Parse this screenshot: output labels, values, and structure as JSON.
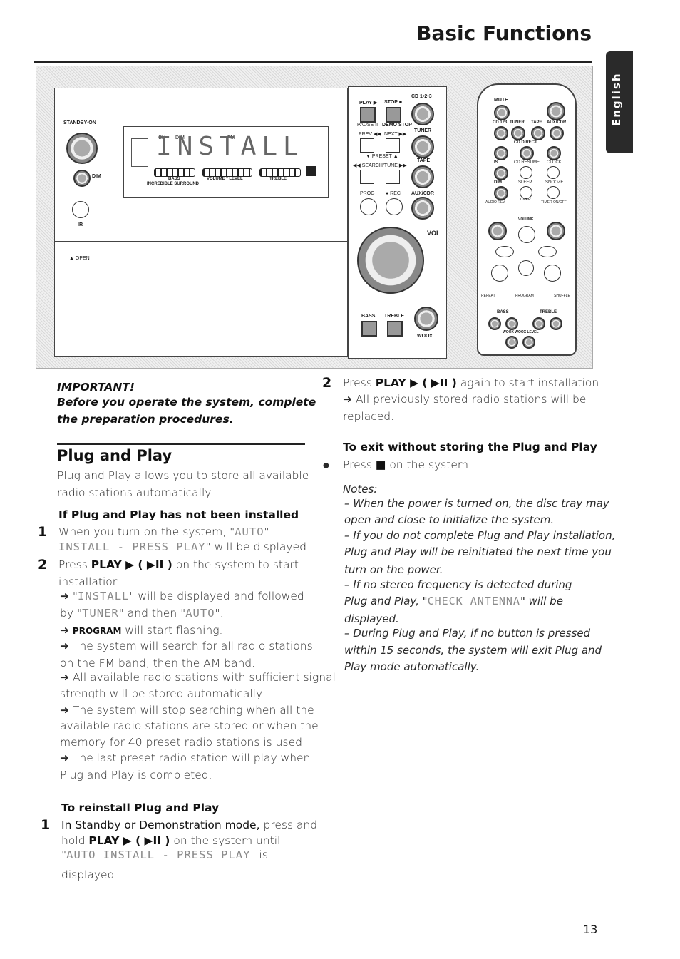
{
  "header": {
    "title": "Basic Functions",
    "language_tab": "English"
  },
  "illustration": {
    "standby": "STANDBY-ON",
    "dim": "DIM",
    "ir": "IR",
    "open": "▲ OPEN",
    "lcd_text": "INSTALL",
    "lcd_top": [
      "CH",
      "DIM",
      "FM"
    ],
    "bass": "BASS",
    "incredible": "INCREDIBLE SURROUND",
    "volume": "VOLUME * LEVEL",
    "treble": "TREBLE",
    "controls": [
      "PLAY ▶",
      "STOP ■",
      "CD 1•2•3",
      "PAUSE II",
      "DEMO STOP",
      "TUNER",
      "PREV ◀◀",
      "NEXT ▶▶",
      "▼ PRESET ▲",
      "◀◀ SEARCH/TUNE ▶▶",
      "TAPE",
      "PROG",
      "● REC",
      "AUX/CDR",
      "VOL",
      "BASS",
      "TREBLE",
      "WOOx"
    ],
    "remote": [
      "MUTE",
      "CD 123",
      "TUNER",
      "TAPE",
      "AUX/CDR",
      "CD DIRECT",
      "IS",
      "CD RESUME",
      "CLOCK",
      "DIM",
      "SLEEP",
      "SNOOZE",
      "AUDIO REV.",
      "TIMER",
      "TIMER ON/OFF",
      "VOLUME",
      "REPEAT",
      "PROGRAM",
      "SHUFFLE",
      "BASS",
      "TREBLE",
      "WOOX WOOX LEVEL"
    ]
  },
  "left": {
    "important": "IMPORTANT!",
    "important_1": "Before you operate the system, complete",
    "important_2": "the preparation procedures.",
    "heading": "Plug and Play",
    "intro": [
      "Plug and Play allows you to store all available",
      "radio stations automatically."
    ],
    "sub1": "If Plug and Play has not been installed",
    "step1_num": "1",
    "step1": [
      "When you turn on the system, \"",
      "AUTO",
      "\"",
      "INSTALL - PRESS PLAY",
      "\" will be displayed."
    ],
    "step2_num": "2",
    "step2": [
      "Press ",
      "PLAY ▶ ( ▶II )",
      " on the system to start",
      "installation."
    ],
    "arrows": [
      [
        "➜ \"",
        "INSTALL",
        "\" will be displayed and followed"
      ],
      [
        "by \"",
        "TUNER",
        "\" and then \"",
        "AUTO",
        "\"."
      ],
      [
        "➜ ",
        "PROGRAM",
        " will start flashing."
      ],
      [
        "➜ The system will search for all radio stations",
        "on the FM band, then the AM band."
      ],
      [
        "➜ All available radio stations with sufficient signal",
        "strength will be stored automatically."
      ],
      [
        "➜ The system will stop searching when all the",
        "available radio stations are stored or when the",
        "memory for 40 preset radio stations is used."
      ],
      [
        "➜ The last preset radio station will play when",
        "Plug and Play is completed."
      ]
    ],
    "sub2": "To reinstall Plug and Play",
    "reinstall_num": "1",
    "reinstall": [
      "In Standby or Demonstration mode,",
      " press and",
      "hold ",
      "PLAY ▶ ( ▶II )",
      " on the system until",
      "\"",
      "AUTO INSTALL - PRESS PLAY",
      "\" is",
      "displayed."
    ]
  },
  "right": {
    "step2_num": "2",
    "step2": [
      "Press ",
      "PLAY ▶ ( ▶II )",
      " again to start installation.",
      "➜ All previously stored radio stations will be",
      "replaced."
    ],
    "sub": "To exit without storing the Plug and Play",
    "bullet": "●",
    "exit": [
      "Press ",
      "■",
      " on the system."
    ],
    "notes_title": "Notes:",
    "notes": [
      "– When the power is turned on, the disc tray may",
      "open and close to initialize the system.",
      "– If you do not complete Plug and Play installation,",
      "Plug and Play will be reinitiated the next time you",
      "turn on the power.",
      "– If no stereo frequency is detected during"
    ],
    "note_check": [
      "Plug and Play, \"",
      "CHECK ANTENNA",
      "\" will be",
      "displayed."
    ],
    "notes2": [
      "– During Plug and Play, if no button is pressed",
      "within 15 seconds, the system will exit Plug and",
      "Play mode automatically."
    ]
  },
  "page_number": "13"
}
